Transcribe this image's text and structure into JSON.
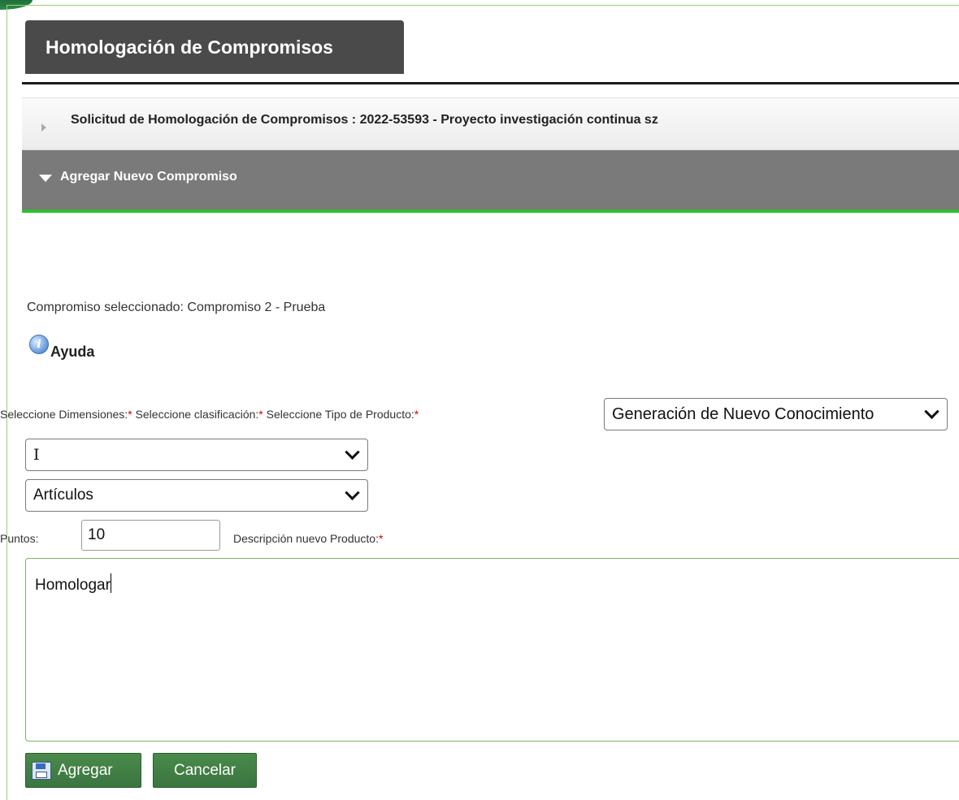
{
  "page": {
    "title": "Homologación de Compromisos"
  },
  "accordion": {
    "request_label": "Solicitud de Homologación de Compromisos : 2022-53593 - Proyecto investigación continua sz",
    "request_expanded": false,
    "add_label": "Agregar Nuevo Compromiso",
    "add_expanded": true
  },
  "form": {
    "selected_commitment": "Compromiso seleccionado: Compromiso 2 - Prueba",
    "help_label": "Ayuda",
    "dimensions_label": "Seleccione Dimensiones:",
    "classification_label": "Seleccione clasificación:",
    "product_type_label": "Seleccione Tipo de Producto:",
    "required_mark": "*",
    "product_type_value": "Generación de Nuevo Conocimiento",
    "dimension_value": "I",
    "classification_value": "Artículos",
    "points_label": "Puntos:",
    "points_value": "10",
    "description_label": "Descripción nuevo Producto:",
    "description_value": "Homologar"
  },
  "buttons": {
    "add_label": "Agregar",
    "cancel_label": "Cancelar"
  },
  "icons": {
    "help": "info-icon",
    "add": "save-icon",
    "collapsed": "triangle-right-icon",
    "expanded": "triangle-down-icon"
  },
  "colors": {
    "title_tab": "#4a4a4a",
    "active_header": "#7a7a7a",
    "accent_green": "#2fbf2f",
    "button_green": "#3f7f45",
    "required": "#d40000"
  }
}
